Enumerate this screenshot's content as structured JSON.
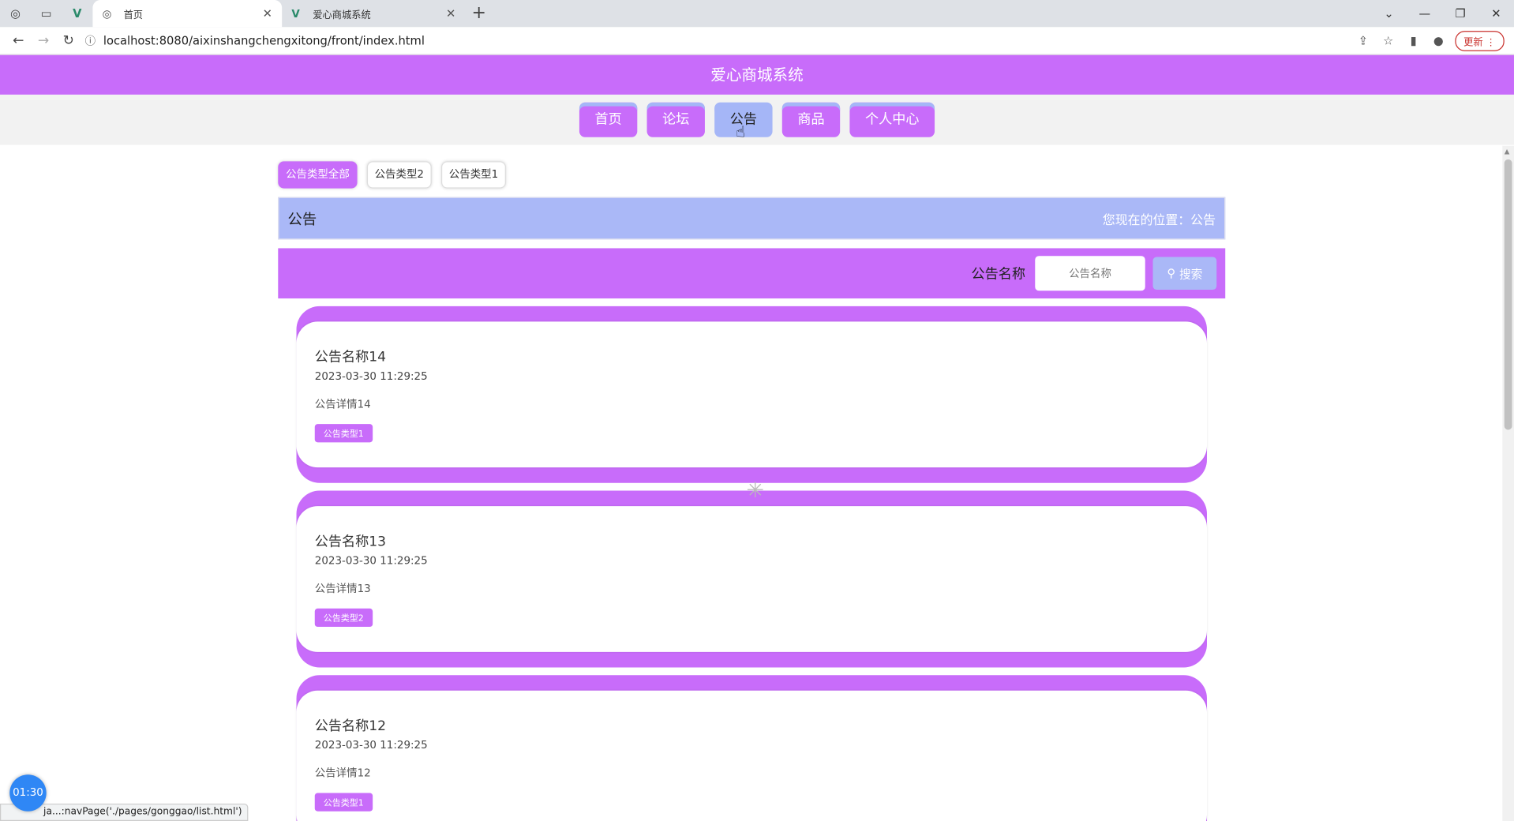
{
  "browser": {
    "tabs": [
      {
        "title": "首页",
        "active": true
      },
      {
        "title": "爱心商城系统",
        "active": false
      }
    ],
    "url": "localhost:8080/aixinshangchengxitong/front/index.html",
    "update_label": "更新"
  },
  "site": {
    "title": "爱心商城系统",
    "nav": [
      "首页",
      "论坛",
      "公告",
      "商品",
      "个人中心"
    ],
    "active_nav": "公告"
  },
  "filters": [
    "公告类型全部",
    "公告类型2",
    "公告类型1"
  ],
  "banner": {
    "title": "公告",
    "location": "您现在的位置：公告"
  },
  "search": {
    "label": "公告名称",
    "placeholder": "公告名称",
    "button": "搜索"
  },
  "notices": [
    {
      "title": "公告名称14",
      "date": "2023-03-30 11:29:25",
      "detail": "公告详情14",
      "type": "公告类型1"
    },
    {
      "title": "公告名称13",
      "date": "2023-03-30 11:29:25",
      "detail": "公告详情13",
      "type": "公告类型2"
    },
    {
      "title": "公告名称12",
      "date": "2023-03-30 11:29:25",
      "detail": "公告详情12",
      "type": "公告类型1"
    }
  ],
  "status_text": "ja...:navPage('./pages/gonggao/list.html')",
  "timer": "01:30",
  "colors": {
    "primary": "#c86cfa",
    "secondary": "#aab8f7"
  }
}
